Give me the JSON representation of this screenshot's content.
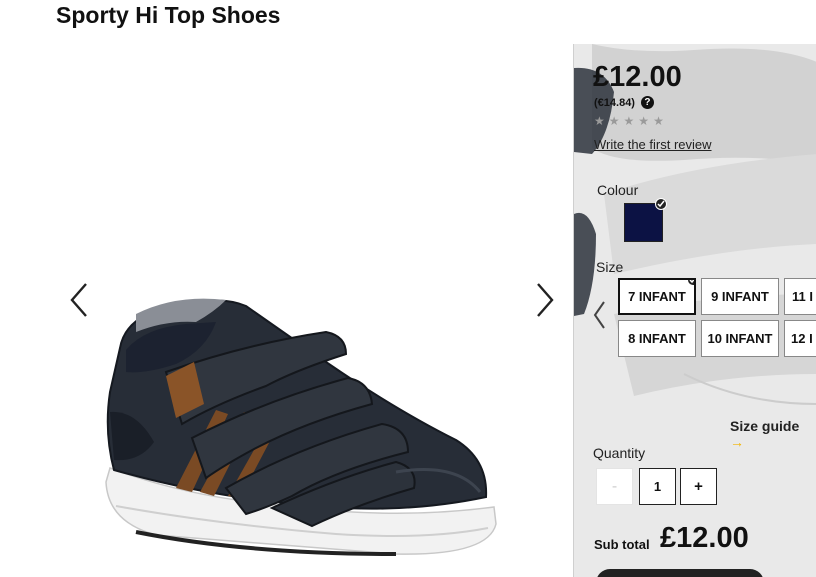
{
  "product": {
    "title": "Sporty Hi Top Shoes",
    "price": "£12.00",
    "price_eur": "(€14.84)",
    "rating_stars": 0,
    "review_link": "Write the first review"
  },
  "colour": {
    "label": "Colour",
    "selected_hex": "#0c1244"
  },
  "size": {
    "label": "Size",
    "options": [
      "7 INFANT",
      "9 INFANT",
      "11 I",
      "8 INFANT",
      "10 INFANT",
      "12 I"
    ],
    "selected": "7 INFANT",
    "guide": "Size guide",
    "guide_arrow": "→"
  },
  "quantity": {
    "label": "Quantity",
    "minus": "-",
    "value": "1",
    "plus": "+"
  },
  "subtotal": {
    "label": "Sub total",
    "value": "£12.00"
  },
  "icons": {
    "prev": "chevron-left-icon",
    "next": "chevron-right-icon",
    "help": "question-icon",
    "check": "check-icon"
  },
  "colors": {
    "selected_swatch": "#0c1244",
    "size_guide_arrow": "#f2b400"
  }
}
